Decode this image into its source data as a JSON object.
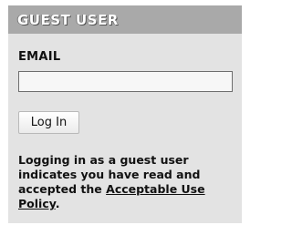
{
  "panel": {
    "title": "GUEST USER"
  },
  "form": {
    "email_label": "EMAIL",
    "email_value": "",
    "email_placeholder": "",
    "login_button_label": "Log In"
  },
  "notice": {
    "text_before": "Logging in as a guest user indicates you have read and accepted the ",
    "link_text": "Acceptable Use Policy",
    "text_after": "."
  }
}
